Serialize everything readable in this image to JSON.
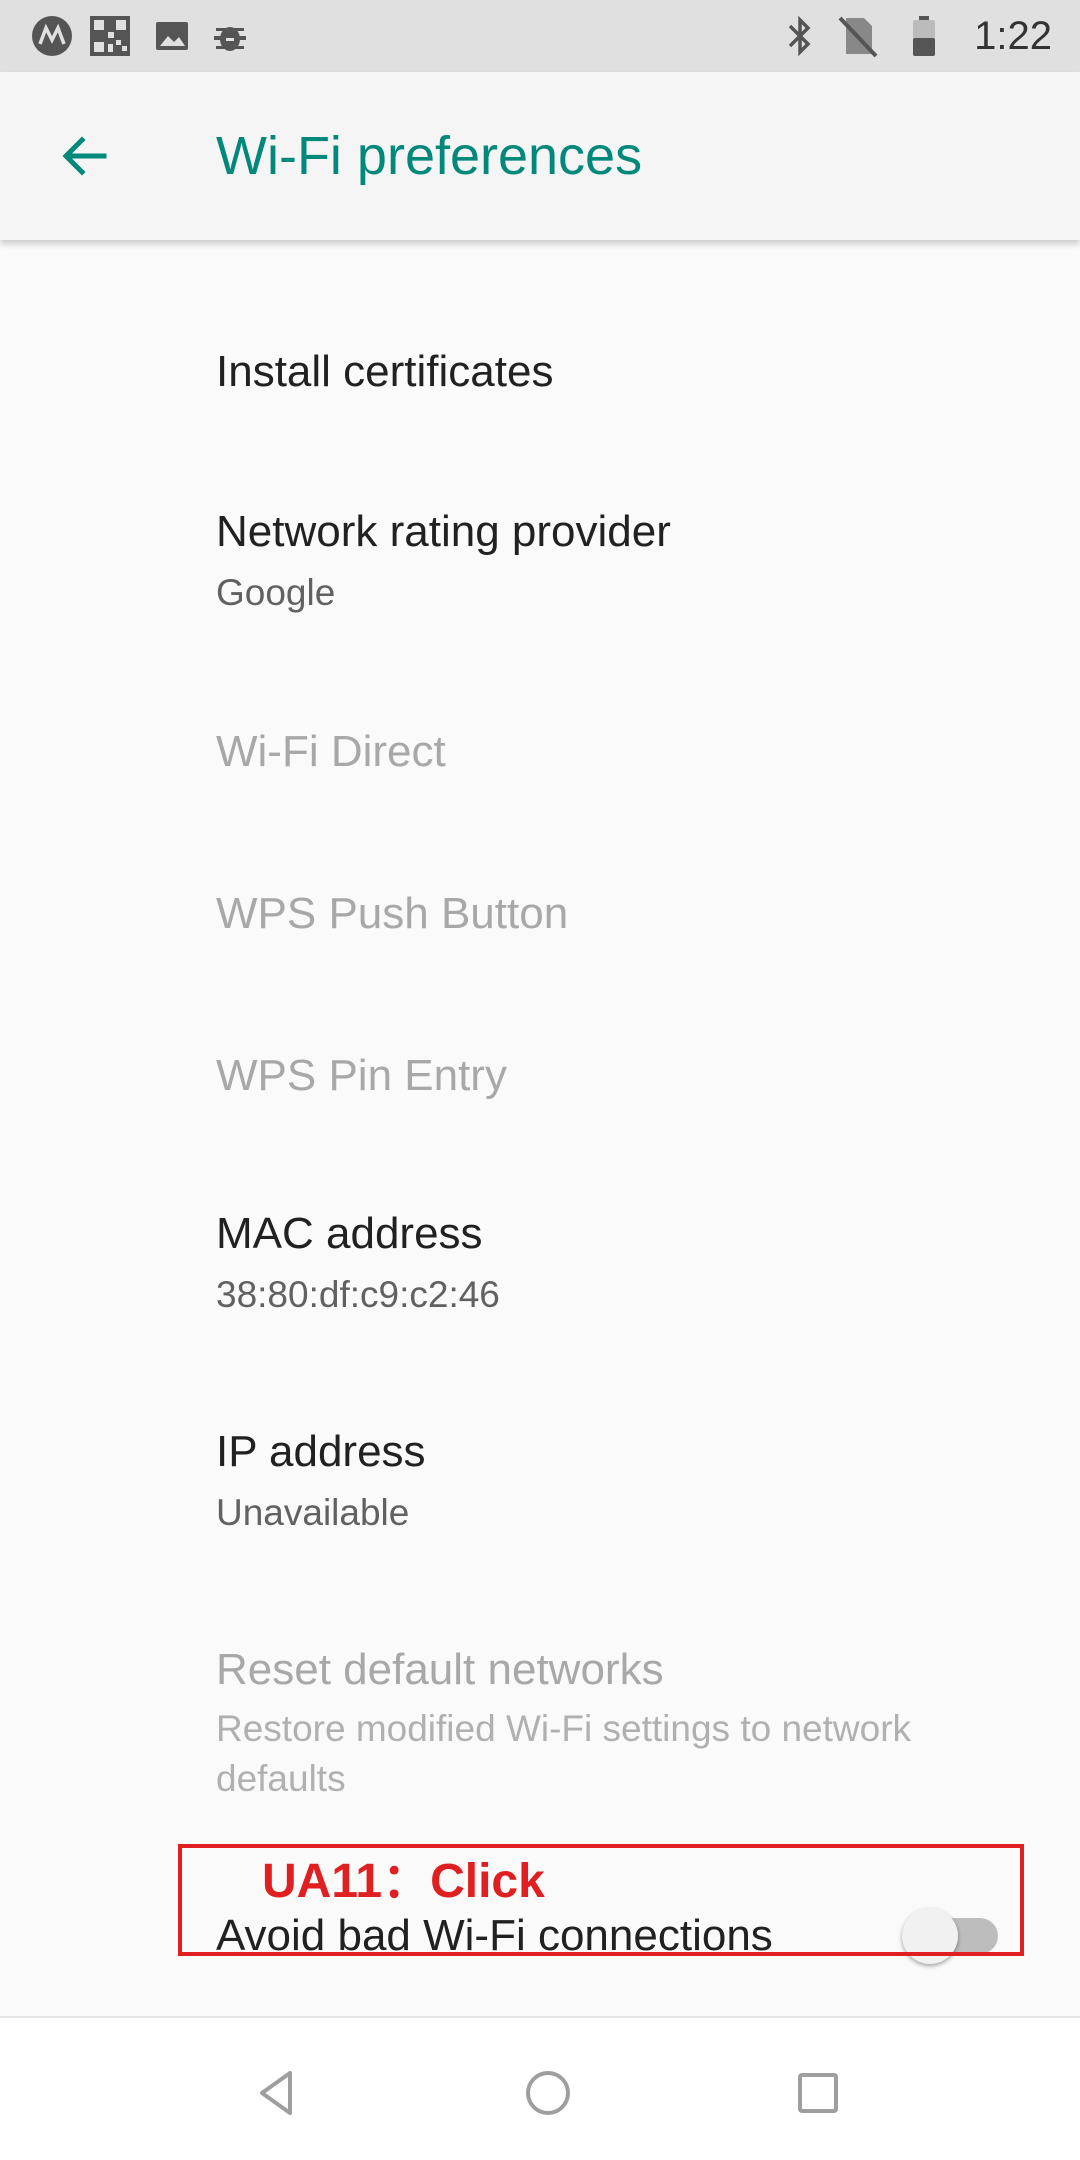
{
  "status_bar": {
    "time": "1:22",
    "left_icons": [
      "motorola-logo-icon",
      "qr-code-icon",
      "image-icon",
      "bug-icon"
    ],
    "right_icons": [
      "bluetooth-icon",
      "no-sim-icon",
      "battery-icon"
    ]
  },
  "app_bar": {
    "title": "Wi-Fi preferences",
    "back_icon": "arrow-back-icon",
    "accent_color": "#00897b"
  },
  "preferences": [
    {
      "title": "Install certificates",
      "summary": "",
      "enabled": true
    },
    {
      "title": "Network rating provider",
      "summary": "Google",
      "enabled": true
    },
    {
      "title": "Wi-Fi Direct",
      "summary": "",
      "enabled": false
    },
    {
      "title": "WPS Push Button",
      "summary": "",
      "enabled": false
    },
    {
      "title": "WPS Pin Entry",
      "summary": "",
      "enabled": false
    },
    {
      "title": "MAC address",
      "summary": "38:80:df:c9:c2:46",
      "enabled": true
    },
    {
      "title": "IP address",
      "summary": "Unavailable",
      "enabled": true
    },
    {
      "title": "Reset default networks",
      "summary": "Restore modified Wi-Fi settings to network defaults",
      "enabled": false
    }
  ],
  "switch_pref": {
    "title": "Avoid bad Wi-Fi connections",
    "checked": false
  },
  "annotation": {
    "label": "UA11：Click",
    "color": "#e02020"
  },
  "nav_bar": {
    "icons": [
      "back-triangle-icon",
      "home-circle-icon",
      "recents-square-icon"
    ]
  }
}
